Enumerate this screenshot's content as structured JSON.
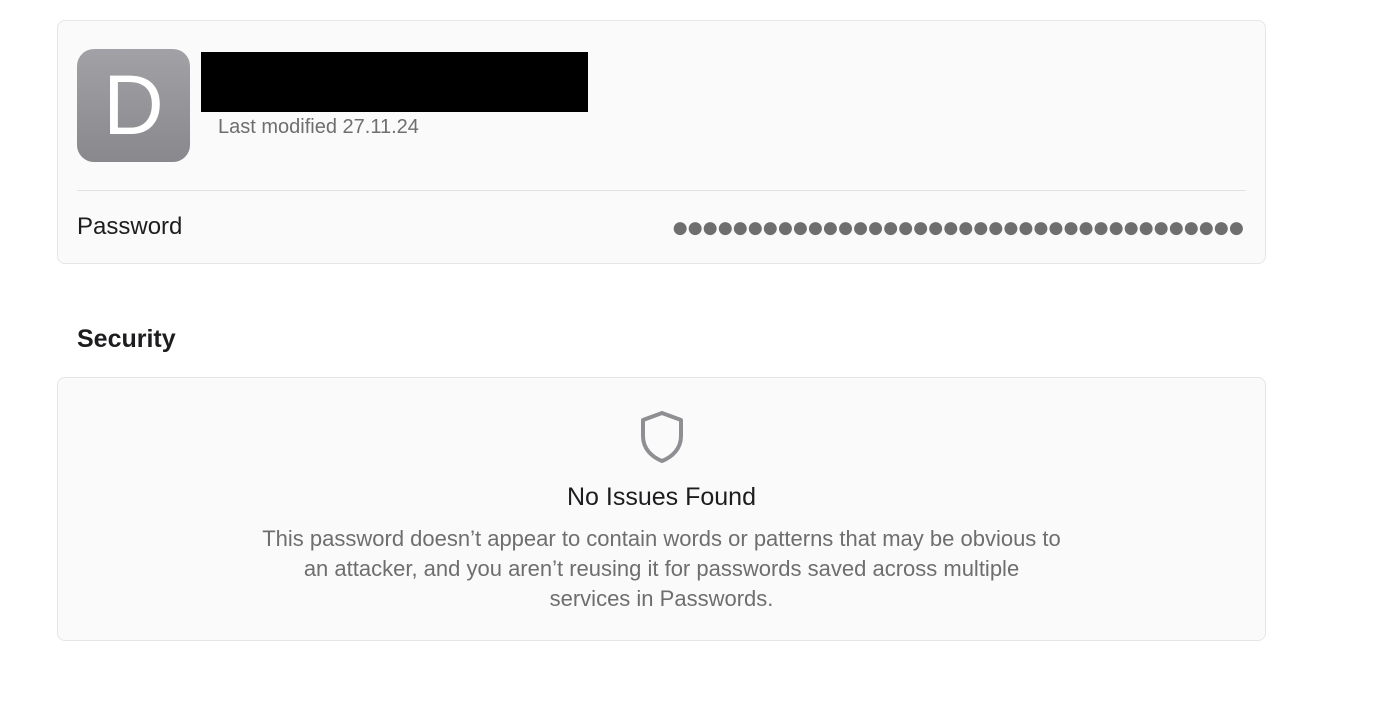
{
  "account": {
    "avatar_letter": "D",
    "title": "",
    "title_redacted": true,
    "last_modified": "Last modified 27.11.24",
    "password_label": "Password",
    "password_mask": "●●●●●●●●●●●●●●●●●●●●●●●●●●●●●●●●●●●●●●"
  },
  "security": {
    "heading": "Security",
    "icon": "shield-icon",
    "status_title": "No Issues Found",
    "status_description": "This password doesn’t appear to contain words or patterns that may be obvious to an attacker, and you aren’t reusing it for passwords saved across multiple services in Passwords."
  },
  "colors": {
    "avatar_bg": "#8e8e93",
    "card_bg": "#fafafa",
    "secondary_text": "#6e6e6e",
    "primary_text": "#1d1d1f",
    "redaction": "#000000"
  }
}
